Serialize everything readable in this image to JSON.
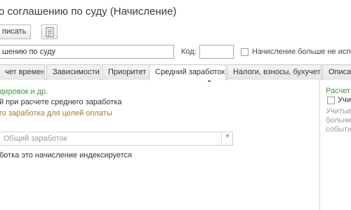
{
  "window": {
    "title": "о соглашению по суду (Начисление)"
  },
  "toolbar": {
    "write_label": "писать",
    "doc_icon": "document-list-icon"
  },
  "form": {
    "name_value": "шению по суду",
    "code_label": "Код:",
    "code_value": "",
    "accrual_more_label": "Начисление больше не испол"
  },
  "tabs": [
    {
      "label": "чет времени",
      "active": false
    },
    {
      "label": "Зависимости",
      "active": false
    },
    {
      "label": "Приоритет",
      "active": false
    },
    {
      "label": "Средний заработок",
      "active": true
    },
    {
      "label": "Налоги, взносы, бухучет",
      "active": false
    },
    {
      "label": "Описание",
      "active": false
    }
  ],
  "avg_tab": {
    "section_heading": "дировок и др.",
    "option_line": "й при расчете среднего заработка",
    "payment_caption": "го заработка для целей оплаты",
    "select_value": "Общий заработок",
    "indexed_line": "ботка это начисление индексируется"
  },
  "right_panel": {
    "heading": "Расчет",
    "checkbox_label": "Учи",
    "desc_lines": [
      "Учитыва",
      "больнич",
      "событи"
    ]
  },
  "colors": {
    "accent_green": "#3a9a3a",
    "caption_brown": "#a07a2e"
  }
}
